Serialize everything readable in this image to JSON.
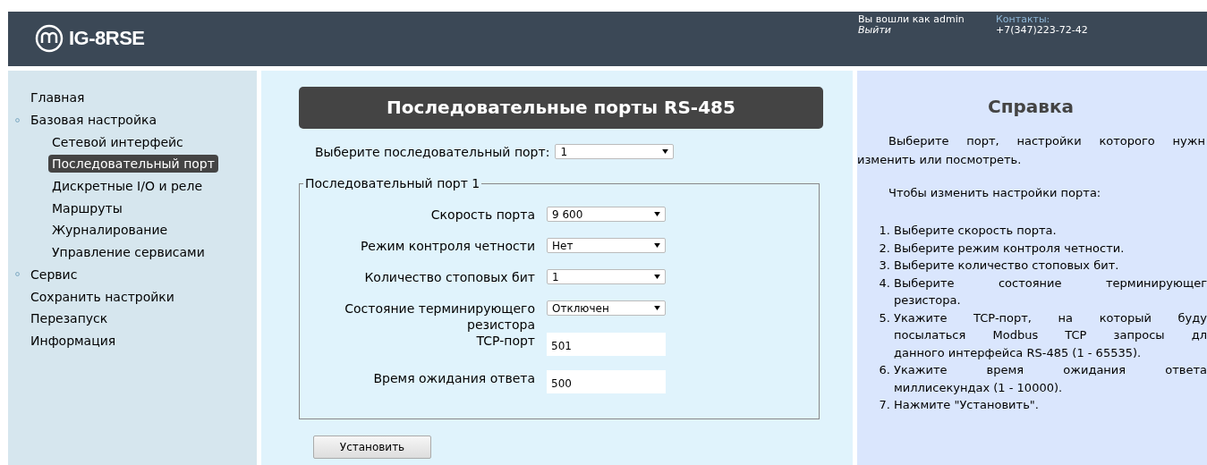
{
  "header": {
    "product": "IG-8RSE",
    "login_text": "Вы вошли как admin",
    "logout": "Выйти",
    "contacts_label": "Контакты:",
    "phone": "+7(347)223-72-42"
  },
  "sidebar": {
    "items": [
      {
        "label": "Главная",
        "kind": "link",
        "selected": false
      },
      {
        "label": "Базовая настройка",
        "kind": "group",
        "selected": false,
        "children": [
          {
            "label": "Сетевой интерфейс",
            "selected": false
          },
          {
            "label": "Последовательный порт",
            "selected": true
          },
          {
            "label": "Дискретные I/O и реле",
            "selected": false
          },
          {
            "label": "Маршруты",
            "selected": false
          },
          {
            "label": "Журналирование",
            "selected": false
          },
          {
            "label": "Управление сервисами",
            "selected": false
          }
        ]
      },
      {
        "label": "Сервис",
        "kind": "group",
        "selected": false
      },
      {
        "label": "Сохранить настройки",
        "kind": "link",
        "selected": false
      },
      {
        "label": "Перезапуск",
        "kind": "link",
        "selected": false
      },
      {
        "label": "Информация",
        "kind": "link",
        "selected": false
      }
    ]
  },
  "main": {
    "title": "Последовательные порты RS-485",
    "port_select": {
      "label": "Выберите последовательный порт:",
      "value": "1"
    },
    "fieldset": {
      "legend": "Последовательный порт 1",
      "fields": [
        {
          "label": "Скорость порта",
          "kind": "select",
          "value": "9 600"
        },
        {
          "label": "Режим контроля четности",
          "kind": "select",
          "value": "Нет"
        },
        {
          "label": "Количество стоповых бит",
          "kind": "select",
          "value": "1"
        },
        {
          "label": "Состояние терминирующего резистора",
          "kind": "select",
          "value": "Отключен"
        },
        {
          "label": "TCP-порт",
          "kind": "input",
          "value": "501"
        },
        {
          "label": "Время ожидания ответа",
          "kind": "input",
          "value": "500"
        }
      ]
    },
    "submit": "Установить"
  },
  "help": {
    "title": "Справка",
    "paragraphs": [
      {
        "lines": [
          "Выберите порт, настройки которого нужн",
          "изменить или посмотреть."
        ]
      },
      {
        "lines": [
          "Чтобы изменить настройки порта:"
        ]
      }
    ],
    "steps": [
      {
        "number": "1.",
        "lines": [
          "Выберите скорость порта."
        ]
      },
      {
        "number": "2.",
        "lines": [
          "Выберите режим контроля четности."
        ]
      },
      {
        "number": "3.",
        "lines": [
          "Выберите количество стоповых бит."
        ]
      },
      {
        "number": "4.",
        "lines": [
          "Выберите состояние терминирующег",
          "резистора."
        ]
      },
      {
        "number": "5.",
        "lines": [
          "Укажите TCP-порт, на который буду",
          "посылаться Modbus TCP запросы дл",
          "данного интерфейса RS-485 (1 - 65535)."
        ]
      },
      {
        "number": "6.",
        "lines": [
          "Укажите время ожидания ответа",
          "миллисекундах (1 - 10000)."
        ]
      },
      {
        "number": "7.",
        "lines": [
          "Нажмите \"Установить\"."
        ]
      }
    ]
  }
}
